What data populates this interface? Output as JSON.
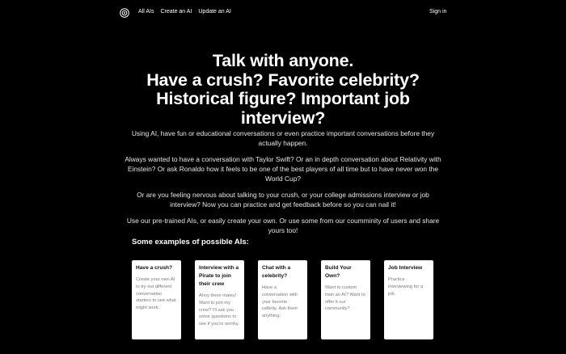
{
  "nav": {
    "logo_icon": "openai-logo-icon",
    "links": [
      "All AIs",
      "Create an AI",
      "Update an AI"
    ],
    "signin": "Sign in"
  },
  "hero": {
    "title_lines": [
      "Talk with anyone.",
      "Have a crush? Favorite celebrity?",
      "Historical figure? Important job",
      "interview?"
    ]
  },
  "paragraphs": [
    "Using AI, have fun or educational conversations or even practice important conversations before they actually happen.",
    "Always wanted to have a conversation with Taylor Swift? Or an in depth conversation about Relativity with Einstein? Or ask Ronaldo how it feels to be one of the best players of all time but to have never won the World Cup?",
    "Or are you feeling nervous about talking to your crush, or your college admissions interview or job interview? Now you can practice and get feedback before so you can nail it!",
    "Use our pre-trained AIs, or easily create your own. Or use some from our coumminity of users and share yours too!"
  ],
  "examples": {
    "heading": "Some examples of possible AIs:",
    "cards": [
      {
        "title": "Have a crush?",
        "desc": "Create your own AI to try out different conversation starters to see what might work."
      },
      {
        "title": "Interview with a Pirate to join their crew",
        "desc": "Ahoy there matey! Want to join my crew? I'll ask you some questions to see if you're worthy."
      },
      {
        "title": "Chat with a celebrity?",
        "desc": "Have a conversation with your favorite celbrity. Ask them anything."
      },
      {
        "title": "Build Your Own?",
        "desc": "Want to custom train an AI? Want to offer it our community?"
      },
      {
        "title": "Job Interview",
        "desc": "Practice interviewing for a job."
      }
    ]
  }
}
